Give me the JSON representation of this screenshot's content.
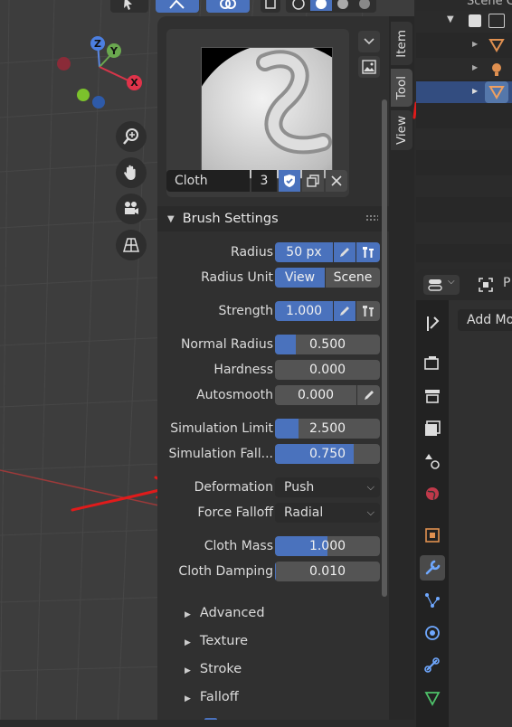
{
  "outliner": {
    "header_text": "Scene C"
  },
  "viewport": {
    "gizmo": {
      "z_label": "Z",
      "y_label": "Y",
      "x_label": "X"
    }
  },
  "n_panel": {
    "tabs": [
      "Item",
      "Tool",
      "View"
    ],
    "active_tab": "Tool",
    "brush": {
      "name": "Cloth",
      "users": "3"
    },
    "section_title": "Brush Settings",
    "properties": {
      "radius": {
        "label": "Radius",
        "value": "50 px"
      },
      "radius_unit": {
        "label": "Radius Unit",
        "options": [
          "View",
          "Scene"
        ],
        "selected": "View"
      },
      "strength": {
        "label": "Strength",
        "value": "1.000"
      },
      "normal_radius": {
        "label": "Normal Radius",
        "value": "0.500",
        "fraction": 0.2
      },
      "hardness": {
        "label": "Hardness",
        "value": "0.000",
        "fraction": 0
      },
      "autosmooth": {
        "label": "Autosmooth",
        "value": "0.000",
        "fraction": 0
      },
      "simulation_limit": {
        "label": "Simulation Limit",
        "value": "2.500",
        "fraction": 0.22
      },
      "simulation_falloff": {
        "label": "Simulation Fall...",
        "value": "0.750",
        "fraction": 0.75
      },
      "deformation": {
        "label": "Deformation",
        "value": "Push"
      },
      "force_falloff": {
        "label": "Force Falloff",
        "value": "Radial"
      },
      "cloth_mass": {
        "label": "Cloth Mass",
        "value": "1.000",
        "fraction": 0.5
      },
      "cloth_damping": {
        "label": "Cloth Damping",
        "value": "0.010",
        "fraction": 0.01
      }
    },
    "subpanels": [
      "Advanced",
      "Texture",
      "Stroke",
      "Falloff"
    ]
  },
  "properties_editor": {
    "header_text": "P",
    "add_modifier_label": "Add Mo"
  },
  "colors": {
    "accent": "#4a72bd",
    "annotation_red": "#e01b1b",
    "panel_bg": "#303030",
    "field_bg": "#545454"
  }
}
